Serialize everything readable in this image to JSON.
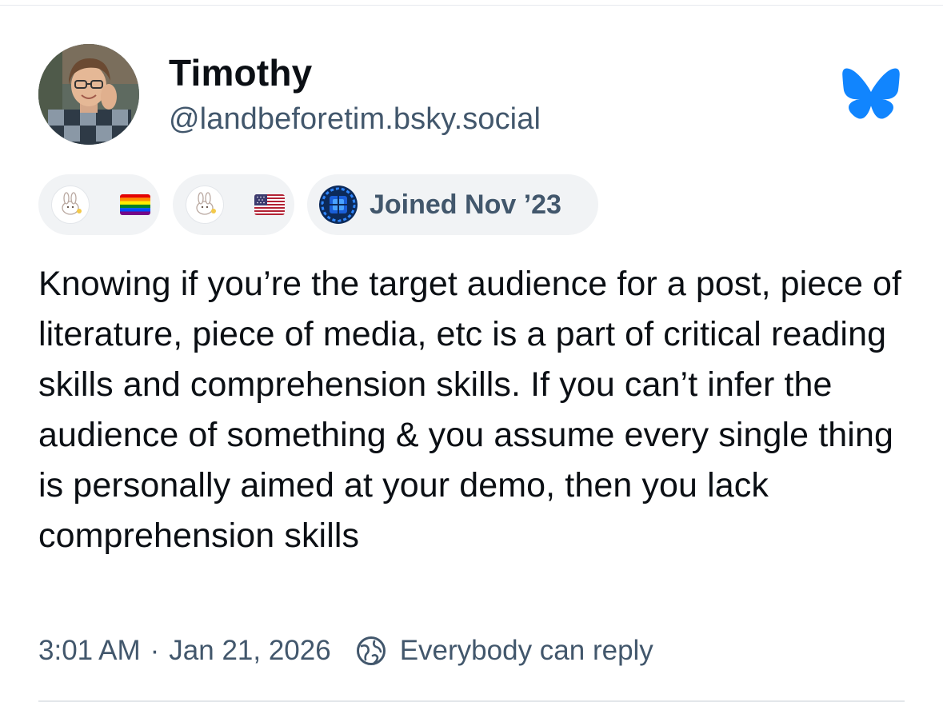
{
  "author": {
    "display_name": "Timothy",
    "handle": "@landbeforetim.bsky.social"
  },
  "icons": {
    "avatar": "profile-photo",
    "logo": "bluesky-butterfly-icon",
    "badge_1": [
      "bunny-icon",
      "rainbow-flag-icon"
    ],
    "badge_2": [
      "bunny-icon",
      "us-flag-icon"
    ],
    "badge_3": "starter-pack-icon",
    "reply_setting": "globe-reply-icon"
  },
  "badges": {
    "joined_label": "Joined Nov ’23"
  },
  "post": {
    "text": "Knowing if you’re the target audience for a post, piece of literature, piece of media, etc is a part of critical reading skills and comprehension skills. If you can’t infer the audience of something & you assume every single thing is personally aimed at your demo, then you lack comprehension skills"
  },
  "footer": {
    "time": "3:01 AM",
    "separator": "·",
    "date": "Jan 21, 2026",
    "reply_setting": "Everybody can reply"
  },
  "colors": {
    "brand_blue": "#1185fe",
    "secondary_text": "#42576c",
    "badge_bg": "#f1f3f5"
  }
}
